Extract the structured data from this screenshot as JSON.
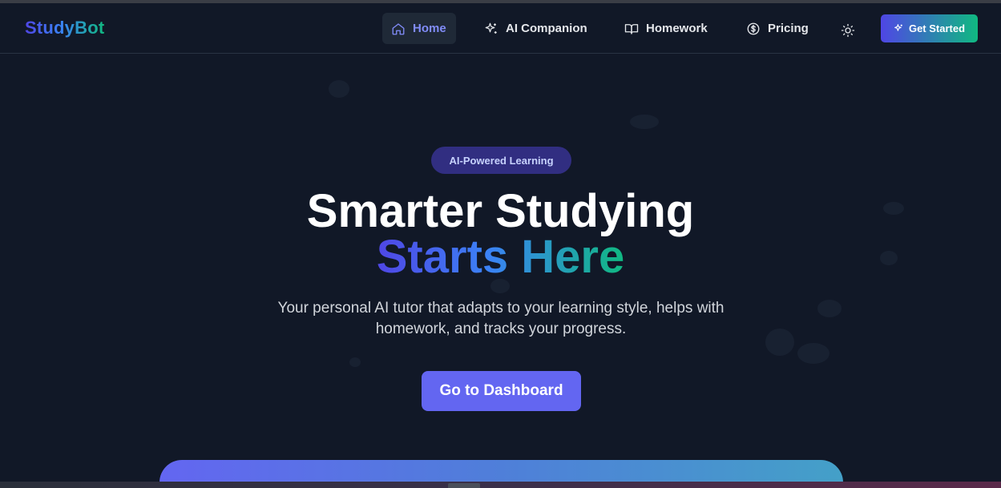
{
  "brand": {
    "name": "StudyBot"
  },
  "nav": {
    "items": [
      {
        "label": "Home",
        "icon": "home-icon",
        "active": true
      },
      {
        "label": "AI Companion",
        "icon": "sparkles-icon",
        "active": false
      },
      {
        "label": "Homework",
        "icon": "book-icon",
        "active": false
      },
      {
        "label": "Pricing",
        "icon": "dollar-circle-icon",
        "active": false
      }
    ],
    "theme_toggle_icon": "sun-icon",
    "cta_label": "Get Started",
    "cta_icon": "sparkles-icon"
  },
  "hero": {
    "badge": "AI-Powered Learning",
    "title_line1": "Smarter Studying",
    "title_line2": "Starts Here",
    "subtitle": "Your personal AI tutor that adapts to your learning style, helps with homework, and tracks your progress.",
    "button_label": "Go to Dashboard"
  },
  "colors": {
    "background": "#111827",
    "accent": "#6366f1",
    "gradient_start": "#4f46e5",
    "gradient_end": "#10b981",
    "badge_bg": "#312e81"
  }
}
